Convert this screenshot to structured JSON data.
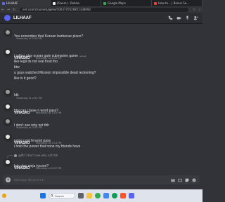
{
  "browser": {
    "tabs": [
      {
        "label": "LILHAAF",
        "icon_color": "#5865f2",
        "active": true
      },
      {
        "label": "(Gaem) - Roblox",
        "icon_color": "#e8eaed",
        "active": false
      },
      {
        "label": "Google Maps",
        "icon_color": "#34a853",
        "active": false
      },
      {
        "label": "How to... | Bonus Se...",
        "icon_color": "#ea4335",
        "active": false
      }
    ],
    "url": "ord.com/channels/@me/1003770526851338692"
  },
  "channel": {
    "title": "LILHAAF",
    "header_icons": [
      "phone-icon",
      "video-icon",
      "pin-icon",
      "add-friend-icon"
    ]
  },
  "messages": [
    {
      "author": "",
      "timestamp": "Yesterday at 2:26 PM",
      "lines": [
        "You remember that Korean barbecue place?"
      ],
      "avatar": "dark"
    },
    {
      "author": "VIHASXO",
      "timestamp": "Yesterday at 2:50 PM",
      "lines": [
        "i rather play ocean gate submarine game",
        "like legit its not real food tho",
        "btw",
        "u guys watched Mission impossible dead reckoning?",
        "like is it good?"
      ],
      "edited_line": 0,
      "edited_label": "(edited)",
      "avatar": "light"
    },
    {
      "author": "",
      "timestamp": "Yesterday at 2:53 PM",
      "lines": [
        "Idk"
      ],
      "avatar": "dark"
    },
    {
      "author": "VIHASXO",
      "timestamp": "Yesterday at 3:03 PM",
      "lines": [
        "btw can i have n word pass?"
      ],
      "avatar": "light"
    },
    {
      "author": "",
      "timestamp": "Yesterday at 3:04 PM",
      "lines": [
        "I don't see why not tbh"
      ],
      "avatar": "dark"
    },
    {
      "author": "VIHASXO",
      "timestamp": "Yesterday at 3:14 PM",
      "lines": [
        "noice i got N word pass",
        "i hold the power that none my friends have"
      ],
      "avatar": "light"
    },
    {
      "author": "VIHASXO",
      "timestamp": "Yesterday at 6:07 PM",
      "reply": "@Mr I don't see why not tbh",
      "lines": [
        "lets play ninja tycoon?"
      ],
      "avatar": "light"
    }
  ],
  "composer": {
    "placeholder": "Message @LILHAAF",
    "icons": [
      "gift-icon",
      "gif-icon",
      "sticker-icon",
      "emoji-icon"
    ]
  },
  "taskbar": {
    "search_placeholder": "Search",
    "weather_color": "#f0a202",
    "apps": [
      {
        "name": "windows-start-icon",
        "color": "#1a73e8"
      },
      {
        "name": "task-view-icon",
        "color": "#5f6368"
      },
      {
        "name": "file-explorer-icon",
        "color": "#f6c343"
      },
      {
        "name": "chrome-icon",
        "color": "#34a853"
      },
      {
        "name": "store-icon",
        "color": "#4285f4"
      },
      {
        "name": "edge-icon",
        "color": "#0f9d58"
      },
      {
        "name": "brave-icon",
        "color": "#fb542b"
      },
      {
        "name": "discord-icon",
        "color": "#5865f2"
      }
    ]
  }
}
